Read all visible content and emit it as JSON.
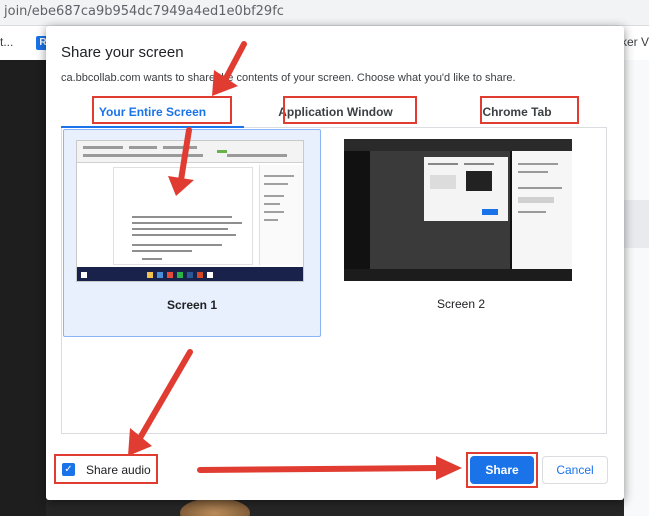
{
  "browser": {
    "url": "join/ebe687ca9b954dc7949a4ed1e0bf29fc",
    "bookmark_left": "t...",
    "bookmark_icon_letter": "R",
    "bookmark_right": "ker V"
  },
  "dialog": {
    "title": "Share your screen",
    "description": "ca.bbcollab.com wants to share the contents of your screen. Choose what you'd like to share.",
    "tabs": [
      {
        "label": "Your Entire Screen",
        "active": true
      },
      {
        "label": "Application Window",
        "active": false
      },
      {
        "label": "Chrome Tab",
        "active": false
      }
    ],
    "screens": [
      {
        "label": "Screen 1",
        "selected": true
      },
      {
        "label": "Screen 2",
        "selected": false
      }
    ],
    "share_audio": {
      "label": "Share audio",
      "checked": true,
      "check_glyph": "✓"
    },
    "buttons": {
      "share": "Share",
      "cancel": "Cancel"
    }
  },
  "colors": {
    "accent": "#1a73e8",
    "annotation_red": "#e03c31",
    "selected_card": "#e8f0fe"
  },
  "icons": {
    "checkbox": "checkmark-icon",
    "annotation": "red-arrow-icon"
  }
}
